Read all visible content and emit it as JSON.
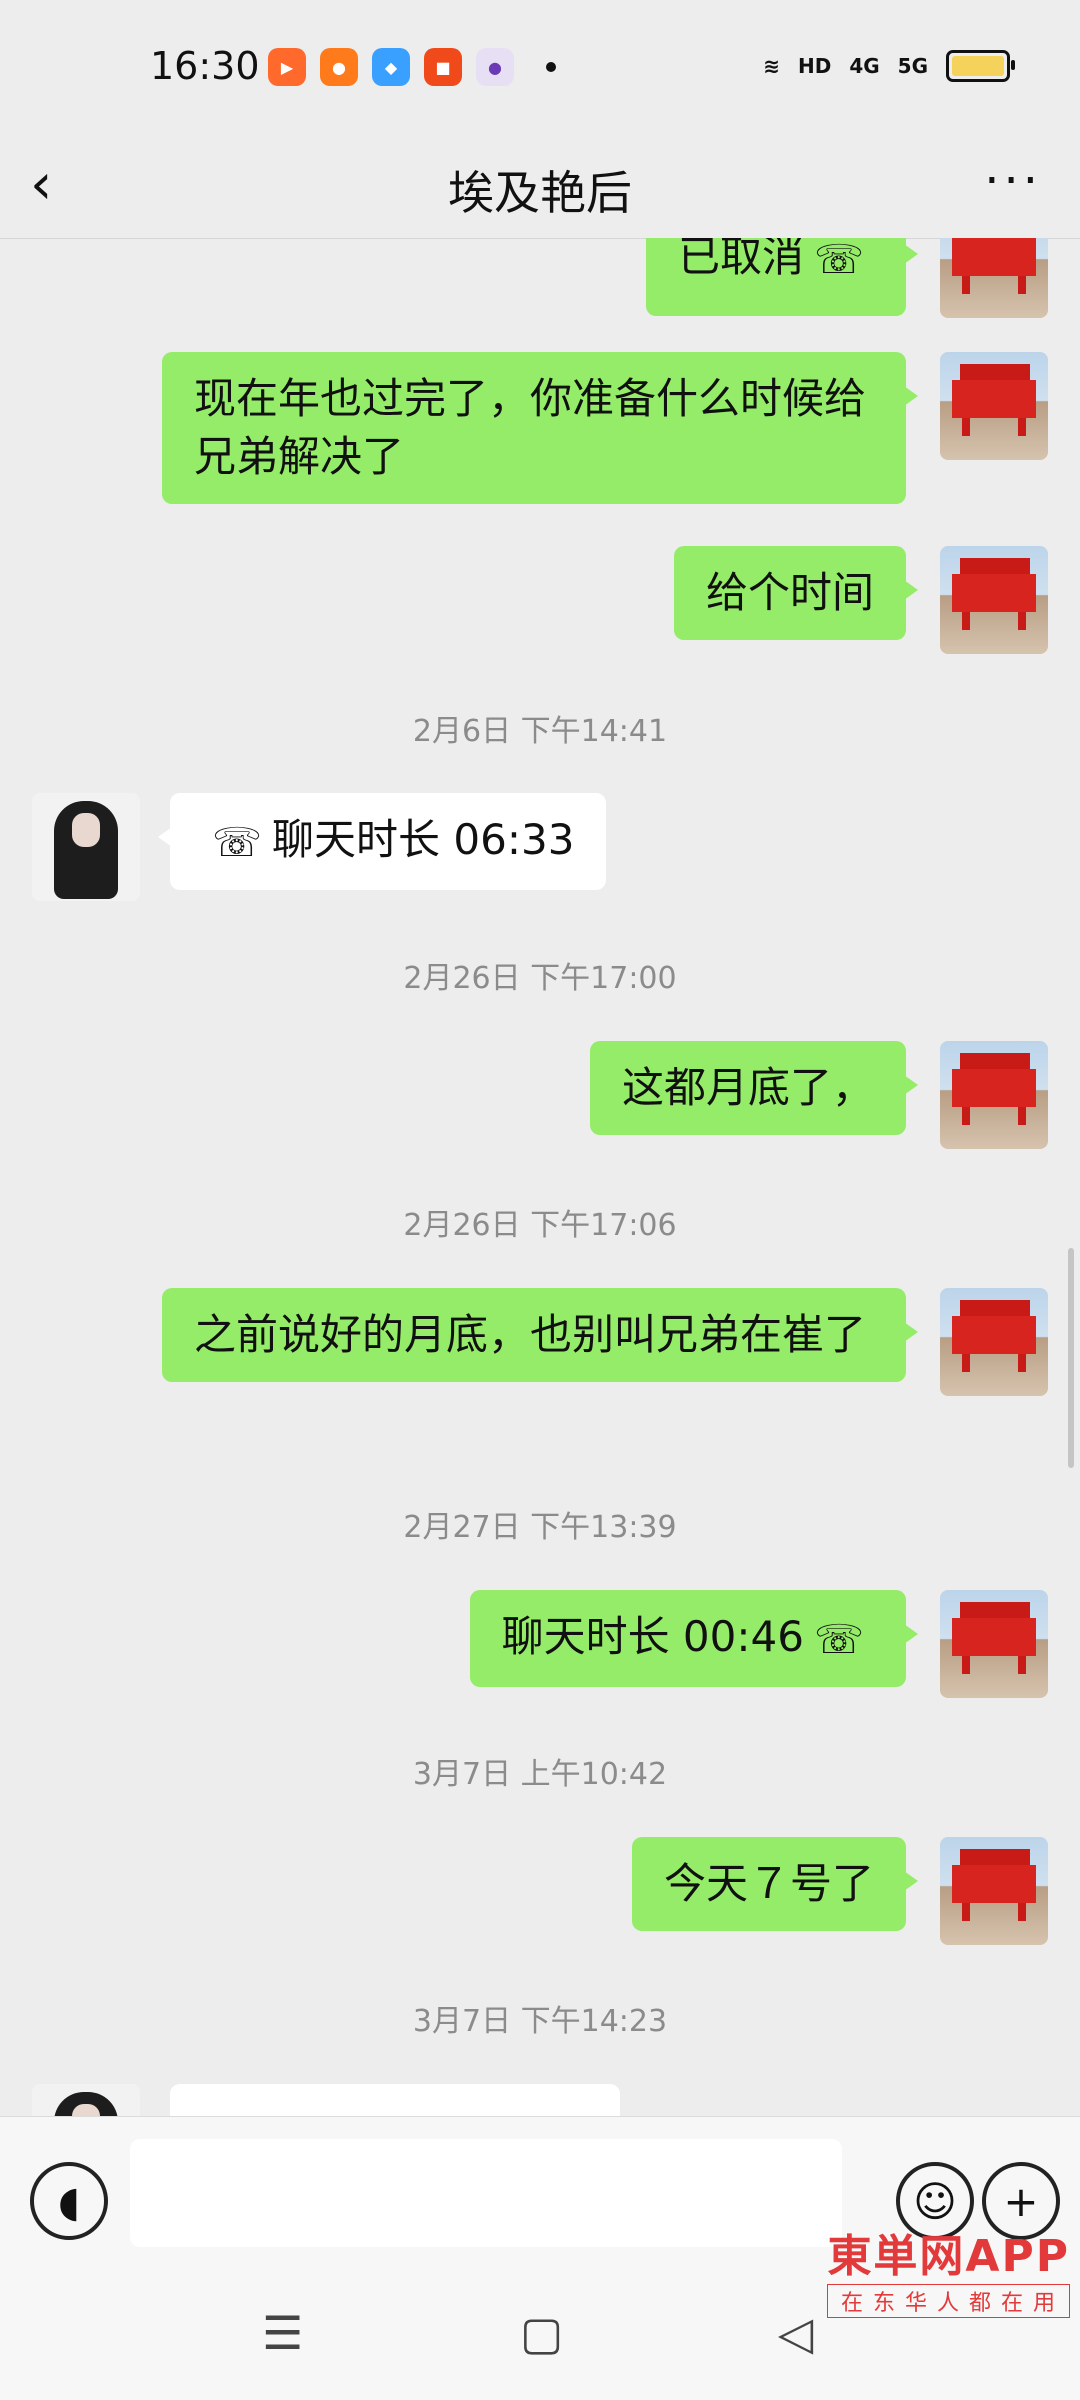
{
  "status_bar": {
    "time": "16:30",
    "network_hd": "HD",
    "network_4g": "4G",
    "network_5g": "5G"
  },
  "header": {
    "title": "埃及艳后"
  },
  "messages": [
    {
      "from": "me",
      "text": "已取消",
      "call": true
    },
    {
      "from": "me",
      "text": "现在年也过完了，你准备什么时候给兄弟解决了"
    },
    {
      "from": "me",
      "text": "给个时间"
    },
    {
      "timestamp": "2月6日 下午14:41"
    },
    {
      "from": "her",
      "text": "聊天时长 06:33",
      "call": true
    },
    {
      "timestamp": "2月26日 下午17:00"
    },
    {
      "from": "me",
      "text": "这都月底了，"
    },
    {
      "timestamp": "2月26日 下午17:06"
    },
    {
      "from": "me",
      "text": "之前说好的月底，也别叫兄弟在崔了"
    },
    {
      "timestamp": "2月27日 下午13:39"
    },
    {
      "from": "me",
      "text": "聊天时长 00:46",
      "call": true
    },
    {
      "timestamp": "3月7日 上午10:42"
    },
    {
      "from": "me",
      "text": "今天７号了"
    },
    {
      "timestamp": "3月7日 下午14:23"
    }
  ],
  "watermark": {
    "main": "東単网APP",
    "sub": "在东华人都在用"
  }
}
